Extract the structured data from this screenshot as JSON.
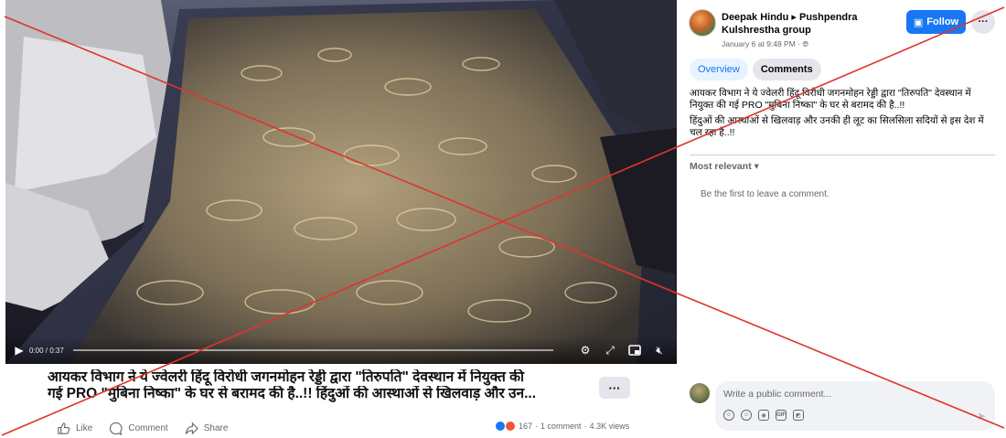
{
  "video": {
    "time": "0:00 / 0:37",
    "progress_fraction": 0.0,
    "play_icon": "play-icon",
    "settings_icon": "gear-icon",
    "expand_icon": "expand-icon",
    "miniplayer_icon": "miniplayer-icon",
    "volume_icon": "volume-muted-icon"
  },
  "caption": {
    "line1": "आयकर विभाग ने ये ज्वेलरी हिंदू विरोधी जगनमोहन रेड्डी द्वारा \"तिरुपति\" देवस्थान में नियुक्त की",
    "line2": "गई PRO \"मुबिना निष्का\" के घर से बरामद की है..!! हिंदुओं की आस्थाओं से खिलवाड़ और उन..."
  },
  "more_button": "···",
  "actions": {
    "like": "Like",
    "comment": "Comment",
    "share": "Share"
  },
  "stats": {
    "reactions": "167",
    "comments": "1 comment",
    "views": "4.3K views",
    "separator": "·"
  },
  "panel": {
    "author": "Deepak Hindu ▸ Pushpendra Kulshrestha group",
    "meta": "January 6 at 9:48 PM · ",
    "follow_label": "Follow",
    "dots_label": "···",
    "tabs": [
      {
        "label": "Overview"
      },
      {
        "label": "Comments"
      }
    ],
    "post_paragraphs": [
      "आयकर विभाग ने ये ज्वेलरी हिंदू विरोधी जगनमोहन रेड्डी द्वारा \"तिरुपति\" देवस्थान में नियुक्त की गई PRO \"मुबिना निष्का\" के घर से बरामद की है..!!",
      "हिंदुओं की आस्थाओं से खिलवाड़ और उनकी ही लूट का सिलसिला सदियों से इस देश में चल रहा है..!!"
    ],
    "sort_label": "Most relevant ▾",
    "empty_note": "Be the first to leave a comment.",
    "comment_placeholder": "Write a public comment..."
  },
  "colors": {
    "accent": "#1877f2",
    "overlay_cross": "#e0342e"
  }
}
